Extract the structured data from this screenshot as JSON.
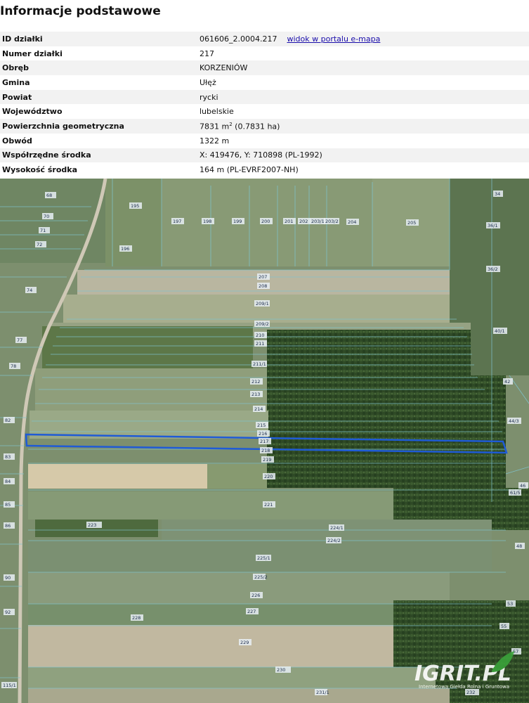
{
  "header": {
    "title": "Informacje podstawowe"
  },
  "info": {
    "id_label": "ID działki",
    "id_value": "061606_2.0004.217",
    "portal_link": "widok w portalu e-mapa",
    "numer_label": "Numer działki",
    "numer_value": "217",
    "obreb_label": "Obręb",
    "obreb_value": "KORZENIÓW",
    "gmina_label": "Gmina",
    "gmina_value": "Ułęż",
    "powiat_label": "Powiat",
    "powiat_value": "rycki",
    "woj_label": "Województwo",
    "woj_value": "lubelskie",
    "pow_label": "Powierzchnia geometryczna",
    "pow_value_main": "7831 m",
    "pow_value_sup": "2",
    "pow_value_rest": " (0.7831 ha)",
    "obwod_label": "Obwód",
    "obwod_value": "1322 m",
    "wsp_label": "Współrzędne środka",
    "wsp_value": "X: 419476, Y: 710898 (PL-1992)",
    "wys_label": "Wysokość środka",
    "wys_value": "164 m (PL-EVRF2007-NH)"
  },
  "map": {
    "parcel_labels": [
      "68",
      "70",
      "71",
      "72",
      "74",
      "77",
      "78",
      "82",
      "83",
      "84",
      "85",
      "86",
      "90",
      "92",
      "115/1",
      "195",
      "196",
      "197",
      "198",
      "199",
      "200",
      "201",
      "202",
      "203/1",
      "203/2",
      "204",
      "205",
      "34",
      "36/1",
      "36/2",
      "40/1",
      "42",
      "44/3",
      "46",
      "48",
      "53",
      "55",
      "57",
      "207",
      "208",
      "209/1",
      "209/2",
      "210",
      "211",
      "211/1",
      "212",
      "213",
      "214",
      "215",
      "216",
      "217",
      "218",
      "219",
      "220",
      "221",
      "223",
      "224/1",
      "224/2",
      "225/1",
      "225/2",
      "226",
      "227",
      "228",
      "229",
      "230",
      "231/1",
      "232",
      "61/5",
      "222"
    ],
    "highlighted_parcel": "217",
    "colors": {
      "parcel_lines": "#7fc4cf",
      "highlight": "#1f5bd6"
    },
    "watermark": {
      "main": "IGRIT.PL",
      "sub": "Internetowa Giełda Rolna i Gruntowa"
    }
  }
}
